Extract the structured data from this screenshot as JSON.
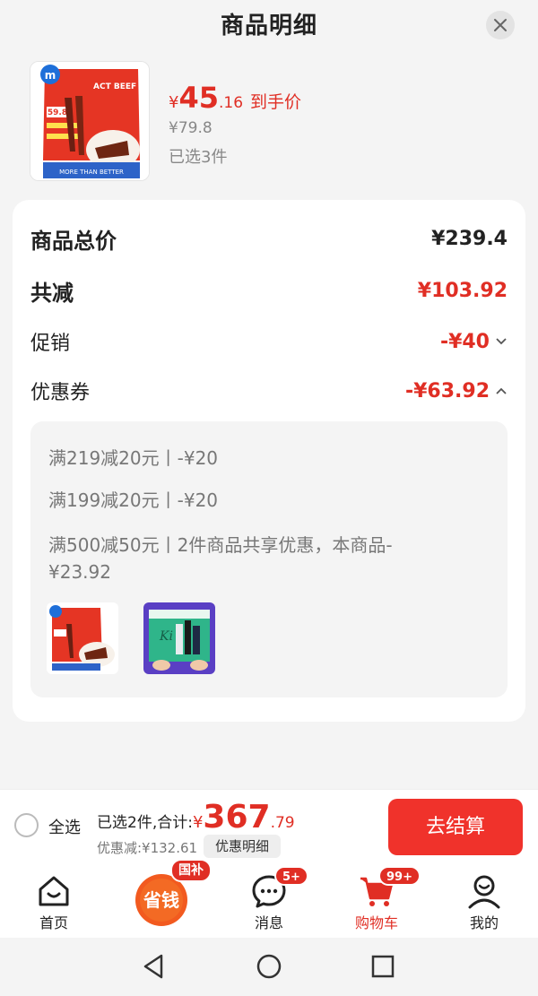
{
  "header": {
    "title": "商品明细"
  },
  "product": {
    "price_yen": "¥",
    "price_int": "45",
    "price_dec": ".16",
    "price_tag": "到手价",
    "original_price": "¥79.8",
    "selected_count": "已选3件",
    "thumb_sticker_price": "59.8",
    "thumb_brand": "ACT BEEF",
    "thumb_slogan": "MORE THAN BETTER"
  },
  "summary": {
    "total_label": "商品总价",
    "total_value": "¥239.4",
    "reduce_label": "共减",
    "reduce_value": "¥103.92",
    "promo_label": "促销",
    "promo_value": "-¥40",
    "coupon_label": "优惠券",
    "coupon_value": "-¥63.92"
  },
  "coupon_details": [
    "满219减20元丨-¥20",
    "满199减20元丨-¥20",
    "满500减50元丨2件商品共享优惠，本商品-¥23.92"
  ],
  "bottom_bar": {
    "select_all": "全选",
    "sum_prefix": "已选2件,合计:",
    "sum_yen": "¥",
    "sum_int": "367",
    "sum_dec": ".79",
    "discount": "优惠减:¥132.61",
    "detail_button": "优惠明细",
    "checkout_button": "去结算"
  },
  "tabbar": {
    "home": "首页",
    "save_money": "省钱",
    "save_badge": "国补",
    "messages": "消息",
    "messages_badge": "5+",
    "cart": "购物车",
    "cart_badge": "99+",
    "me": "我的"
  },
  "colors": {
    "accent": "#e02e24",
    "checkout": "#f0322b"
  }
}
